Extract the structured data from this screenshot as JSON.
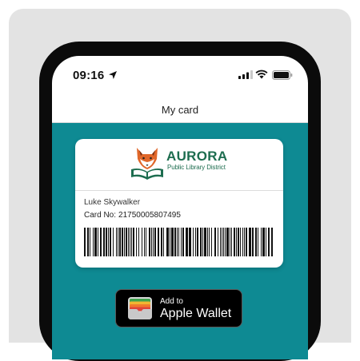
{
  "status_bar": {
    "time": "09:16"
  },
  "nav": {
    "title": "My card"
  },
  "library": {
    "name": "AURORA",
    "subtitle": "Public Library District"
  },
  "card": {
    "holder_name": "Luke Skywalker",
    "number_label": "Card No:",
    "number": "21750005807495"
  },
  "wallet": {
    "small_label": "Add to",
    "big_label": "Apple Wallet"
  },
  "colors": {
    "teal": "#0e8a93",
    "logo_green": "#1d6d4f",
    "fox_orange": "#e0672a"
  }
}
